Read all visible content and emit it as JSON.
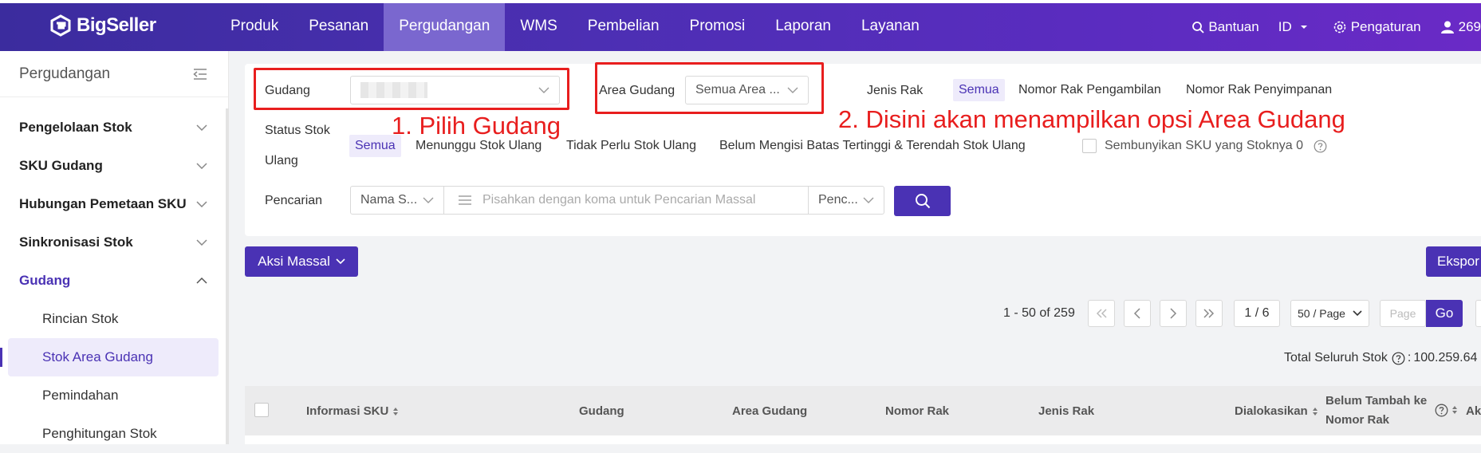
{
  "header": {
    "logo_text": "BigSeller",
    "nav": [
      "Produk",
      "Pesanan",
      "Pergudangan",
      "WMS",
      "Pembelian",
      "Promosi",
      "Laporan",
      "Layanan"
    ],
    "active_nav": "Pergudangan",
    "help_label": "Bantuan",
    "lang_label": "ID",
    "settings_label": "Pengaturan",
    "user_label": "269"
  },
  "sidebar": {
    "title": "Pergudangan",
    "groups": [
      {
        "label": "Pengelolaan Stok"
      },
      {
        "label": "SKU Gudang"
      },
      {
        "label": "Hubungan Pemetaan SKU"
      },
      {
        "label": "Sinkronisasi Stok"
      },
      {
        "label": "Gudang"
      }
    ],
    "sub_items": [
      "Rincian Stok",
      "Stok Area Gudang",
      "Pemindahan",
      "Penghitungan Stok"
    ],
    "active_sub": "Stok Area Gudang"
  },
  "filters": {
    "warehouse_label": "Gudang",
    "area_label": "Area Gudang",
    "area_value": "Semua Area ...",
    "rack_type_label": "Jenis Rak",
    "rack_type_options": [
      "Semua",
      "Nomor Rak Pengambilan",
      "Nomor Rak Penyimpanan"
    ],
    "restock_label_line1": "Status Stok",
    "restock_label_line2": "Ulang",
    "restock_options": [
      "Semua",
      "Menunggu Stok Ulang",
      "Tidak Perlu Stok Ulang",
      "Belum Mengisi Batas Tertinggi & Terendah Stok Ulang"
    ],
    "hide_zero_label": "Sembunyikan SKU yang Stoknya 0",
    "search_label": "Pencarian",
    "search_field_value": "Nama S...",
    "search_placeholder": "Pisahkan dengan koma untuk Pencarian Massal",
    "search_mode_value": "Penc..."
  },
  "annotations": {
    "step1": "1. Pilih Gudang",
    "step2": "2. Disini akan menampilkan opsi Area Gudang"
  },
  "toolbar": {
    "bulk_action_label": "Aksi Massal",
    "export_label": "Ekspor"
  },
  "pagination": {
    "range_text": "1 - 50 of 259",
    "page_indicator": "1 / 6",
    "page_size": "50 / Page",
    "page_placeholder": "Page",
    "go_label": "Go"
  },
  "total_stock": {
    "label": "Total Seluruh Stok",
    "value": "100.259.64"
  },
  "table": {
    "headers": [
      "Informasi SKU",
      "Gudang",
      "Area Gudang",
      "Nomor Rak",
      "Jenis Rak",
      "Dialokasikan",
      "Belum Tambah ke",
      "Nomor Rak",
      "Ak"
    ]
  },
  "colors": {
    "brand": "#4a32b4",
    "annotation": "#e81e1e"
  }
}
